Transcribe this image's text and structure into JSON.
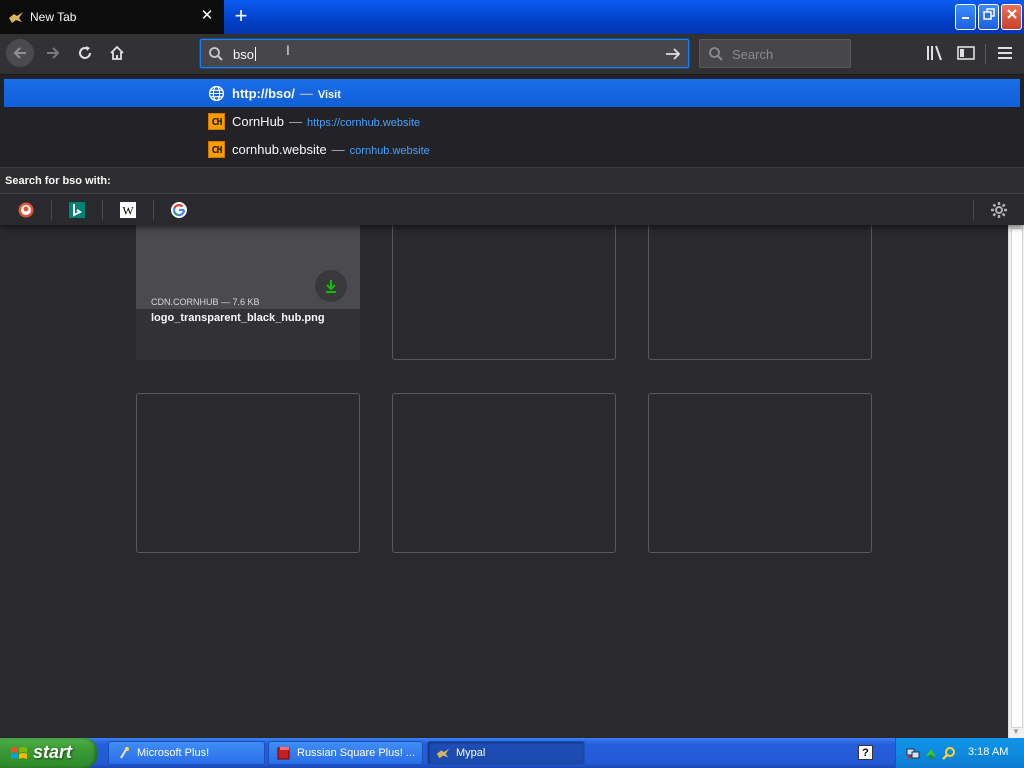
{
  "window": {
    "tab_title": "New Tab",
    "tab_close": "✕",
    "new_tab": "+"
  },
  "navbar": {
    "url_value": "bso",
    "search_placeholder": "Search"
  },
  "autocomplete": {
    "results": [
      {
        "title": "http://bso/",
        "action": "Visit",
        "icon": "globe-icon"
      },
      {
        "title": "CornHub",
        "url": "https://cornhub.website",
        "icon": "CH"
      },
      {
        "title": "cornhub.website",
        "url": "cornhub.website",
        "icon": "CH"
      }
    ],
    "search_with_label": "Search for bso with:",
    "engines": [
      "DuckDuckGo",
      "Bing",
      "Wikipedia",
      "Google"
    ],
    "dash": "—"
  },
  "newtab": {
    "tiles": [
      {
        "source": "CDN.CORNHUB — 7.6 KB",
        "name": "logo_transparent_black_hub.png"
      }
    ]
  },
  "taskbar": {
    "start_label": "start",
    "buttons": [
      "Microsoft Plus!",
      "Russian Square Plus! ...",
      "Mypal"
    ],
    "clock": "3:18 AM"
  },
  "colors": {
    "accent": "#0a84ff",
    "link": "#45a1ff",
    "download_green": "#12bc00"
  }
}
